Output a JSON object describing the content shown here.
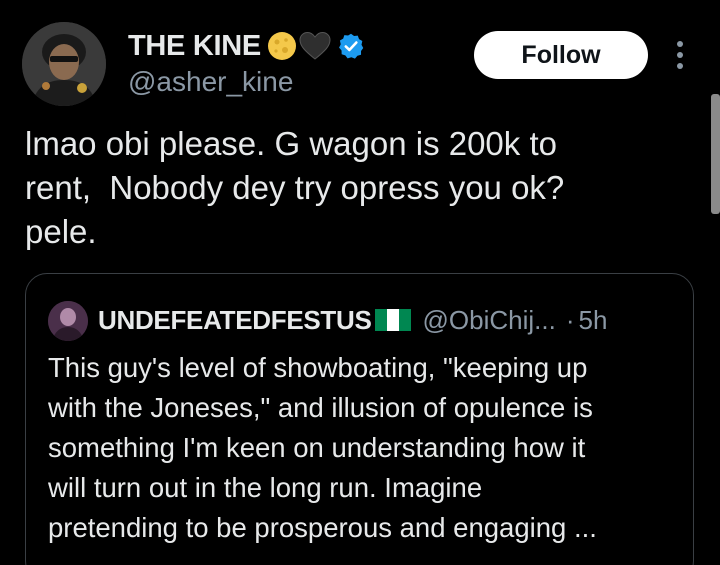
{
  "tweet": {
    "author": {
      "name": "THE KINE",
      "handle": "@asher_kine",
      "verified": true,
      "name_emojis": [
        "moon-emoji",
        "black-heart-emoji"
      ]
    },
    "follow_label": "Follow",
    "text_lines": [
      "lmao obi please. G wagon is 200k to",
      "rent,  Nobody dey try opress you ok?",
      "pele."
    ]
  },
  "quote": {
    "author_name": "UNDEFEATEDFESTUS",
    "name_emoji": "nigeria-flag-emoji",
    "handle": "@ObiChij...",
    "separator": "·",
    "time": "5h",
    "text_lines": [
      "This guy's level of showboating, \"keeping up",
      "with the Joneses,\" and illusion of opulence is",
      "something I'm keen on understanding how it",
      "will turn out in the long run. Imagine",
      "pretending to be prosperous and engaging ..."
    ]
  },
  "colors": {
    "background": "#000000",
    "text_primary": "#e7e9ea",
    "text_secondary": "#8b98a5",
    "verified_blue": "#1d9bf0",
    "follow_bg": "#ffffff",
    "follow_text": "#0f1419",
    "card_border": "#3a3f44"
  }
}
